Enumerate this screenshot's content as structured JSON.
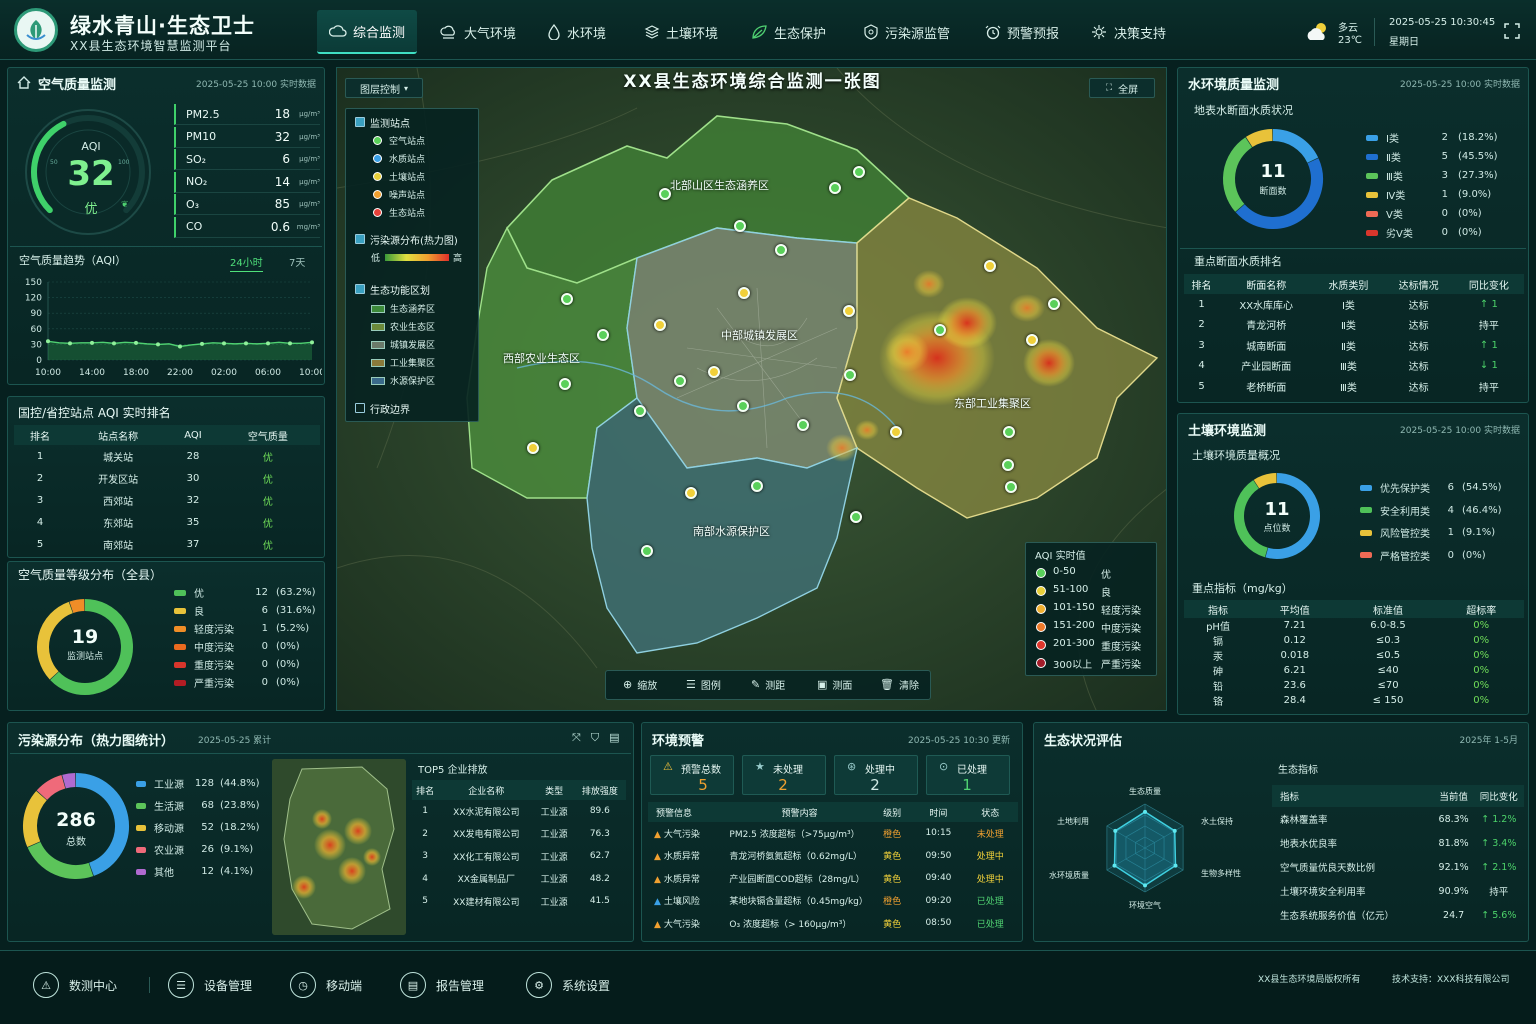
{
  "header": {
    "title": "绿水青山·生态卫士",
    "subtitle": "XX县生态环境智慧监测平台",
    "nav": [
      {
        "label": "综合监测",
        "icon": "cloud-monitor-icon",
        "active": true
      },
      {
        "label": "大气环境",
        "icon": "air-icon"
      },
      {
        "label": "水环境",
        "icon": "water-drop-icon"
      },
      {
        "label": "土壤环境",
        "icon": "soil-icon"
      },
      {
        "label": "生态保护",
        "icon": "leaf-icon"
      },
      {
        "label": "污染源监管",
        "icon": "pollution-source-icon"
      },
      {
        "label": "预警预报",
        "icon": "alarm-icon"
      },
      {
        "label": "决策支持",
        "icon": "decision-icon"
      }
    ],
    "weather": {
      "desc": "多云",
      "temp": "23℃"
    },
    "datetime": "2025-05-25  10:30:45",
    "weekday": "星期日"
  },
  "air": {
    "title": "空气质量监测",
    "meta": "2025-05-25  10:00  实时数据",
    "aqi_label": "AQI",
    "aqi_value": "32",
    "aqi_level": "优",
    "aqi_fraction": 0.16,
    "pollutants": [
      {
        "name": "PM2.5",
        "value": "18",
        "unit": "μg/m³"
      },
      {
        "name": "PM10",
        "value": "32",
        "unit": "μg/m³"
      },
      {
        "name": "SO₂",
        "value": "6",
        "unit": "μg/m³"
      },
      {
        "name": "NO₂",
        "value": "14",
        "unit": "μg/m³"
      },
      {
        "name": "O₃",
        "value": "85",
        "unit": "μg/m³"
      },
      {
        "name": "CO",
        "value": "0.6",
        "unit": "mg/m³"
      }
    ],
    "trend_title": "空气质量趋势（AQI）",
    "trend_tabs": [
      "24小时",
      "7天"
    ]
  },
  "chart_data": {
    "type": "line",
    "title": "空气质量趋势（AQI）",
    "x": [
      "10:00",
      "11:00",
      "12:00",
      "13:00",
      "14:00",
      "15:00",
      "16:00",
      "17:00",
      "18:00",
      "19:00",
      "20:00",
      "21:00",
      "22:00",
      "23:00",
      "00:00",
      "01:00",
      "02:00",
      "03:00",
      "04:00",
      "05:00",
      "06:00",
      "07:00",
      "08:00",
      "09:00",
      "10:00"
    ],
    "xticks": [
      "10:00",
      "14:00",
      "18:00",
      "22:00",
      "02:00",
      "06:00",
      "10:00"
    ],
    "values": [
      36,
      33,
      32,
      33,
      33,
      34,
      32,
      34,
      33,
      31,
      30,
      31,
      26,
      29,
      31,
      33,
      32,
      31,
      32,
      31,
      32,
      34,
      32,
      32,
      34
    ],
    "yticks": [
      0,
      30,
      60,
      90,
      120,
      150
    ],
    "ylim": [
      0,
      150
    ],
    "color": "#4fd071"
  },
  "aqi_rank": {
    "title": "国控/省控站点 AQI 实时排名",
    "headers": [
      "排名",
      "站点名称",
      "AQI",
      "空气质量"
    ],
    "rows": [
      [
        "1",
        "城关站",
        "28",
        "优"
      ],
      [
        "2",
        "开发区站",
        "30",
        "优"
      ],
      [
        "3",
        "西郊站",
        "32",
        "优"
      ],
      [
        "4",
        "东郊站",
        "35",
        "优"
      ],
      [
        "5",
        "南郊站",
        "37",
        "优"
      ]
    ]
  },
  "aqi_dist": {
    "title": "空气质量等级分布（全县）",
    "total": "19",
    "total_label": "监测站点",
    "items": [
      {
        "name": "优",
        "count": "12",
        "pct": "(63.2%)",
        "value": 12,
        "color": "#4fc159"
      },
      {
        "name": "良",
        "count": "6",
        "pct": "(31.6%)",
        "value": 6,
        "color": "#e8c23a"
      },
      {
        "name": "轻度污染",
        "count": "1",
        "pct": "(5.2%)",
        "value": 1,
        "color": "#f08d27"
      },
      {
        "name": "中度污染",
        "count": "0",
        "pct": "(0%)",
        "value": 0,
        "color": "#ea6a1f"
      },
      {
        "name": "重度污染",
        "count": "0",
        "pct": "(0%)",
        "value": 0,
        "color": "#d9362c"
      },
      {
        "name": "严重污染",
        "count": "0",
        "pct": "(0%)",
        "value": 0,
        "color": "#b31d24"
      }
    ]
  },
  "map": {
    "title": "XX县生态环境综合监测一张图",
    "layer_btn": "图层控制",
    "fullscreen": "全屏",
    "layers": {
      "stations_title": "监测站点",
      "stations": [
        {
          "label": "空气站点",
          "color": "#5ad05a"
        },
        {
          "label": "水质站点",
          "color": "#3aa0e6"
        },
        {
          "label": "土壤站点",
          "color": "#e8d03a"
        },
        {
          "label": "噪声站点",
          "color": "#f0a030"
        },
        {
          "label": "生态站点",
          "color": "#e8413a"
        }
      ],
      "heat_title": "污染源分布(热力图)",
      "heat_low": "低",
      "heat_high": "高",
      "zones_title": "生态功能区划",
      "zones": [
        {
          "label": "生态涵养区",
          "color": "#3d8a3a"
        },
        {
          "label": "农业生态区",
          "color": "#6c8a3a"
        },
        {
          "label": "城镇发展区",
          "color": "#6b7a6a"
        },
        {
          "label": "工业集聚区",
          "color": "#8a7a3a"
        },
        {
          "label": "水源保护区",
          "color": "#3a6a8a"
        }
      ],
      "boundary": "行政边界"
    },
    "regions": {
      "north": "北部山区生态涵养区",
      "west": "西部农业生态区",
      "center": "中部城镇发展区",
      "east": "东部工业集聚区",
      "south": "南部水源保护区"
    },
    "aqi_legend_title": "AQI 实时值",
    "aqi_legend": [
      {
        "range": "0-50",
        "level": "优",
        "color": "#5ad05a"
      },
      {
        "range": "51-100",
        "level": "良",
        "color": "#e8d03a"
      },
      {
        "range": "101-150",
        "level": "轻度污染",
        "color": "#f0b030"
      },
      {
        "range": "151-200",
        "level": "中度污染",
        "color": "#ef7a2a"
      },
      {
        "range": "201-300",
        "level": "重度污染",
        "color": "#e0372d"
      },
      {
        "range": "300以上",
        "level": "严重污染",
        "color": "#a31d2a"
      }
    ],
    "tools": [
      {
        "label": "缩放",
        "icon": "zoom-icon"
      },
      {
        "label": "图例",
        "icon": "legend-icon"
      },
      {
        "label": "测距",
        "icon": "ruler-icon"
      },
      {
        "label": "测面",
        "icon": "area-measure-icon"
      },
      {
        "label": "清除",
        "icon": "trash-icon"
      }
    ]
  },
  "water": {
    "title": "水环境质量监测",
    "meta": "2025-05-25  10:00  实时数据",
    "section_title": "地表水断面水质状况",
    "total": "11",
    "total_label": "断面数",
    "classes": [
      {
        "name": "Ⅰ类",
        "count": "2",
        "pct": "(18.2%)",
        "value": 2,
        "color": "#3aa0e6"
      },
      {
        "name": "Ⅱ类",
        "count": "5",
        "pct": "(45.5%)",
        "value": 5,
        "color": "#1f6fd0"
      },
      {
        "name": "Ⅲ类",
        "count": "3",
        "pct": "(27.3%)",
        "value": 3,
        "color": "#5cc45a"
      },
      {
        "name": "Ⅳ类",
        "count": "1",
        "pct": "(9.0%)",
        "value": 1,
        "color": "#e8c23a"
      },
      {
        "name": "Ⅴ类",
        "count": "0",
        "pct": "(0%)",
        "value": 0,
        "color": "#ef6a55"
      },
      {
        "name": "劣Ⅴ类",
        "count": "0",
        "pct": "(0%)",
        "value": 0,
        "color": "#d9362c"
      }
    ],
    "rank_title": "重点断面水质排名",
    "rank_headers": [
      "排名",
      "断面名称",
      "水质类别",
      "达标情况",
      "同比变化"
    ],
    "rank_rows": [
      {
        "cells": [
          "1",
          "XX水库库心",
          "Ⅰ类",
          "达标"
        ],
        "change": "↑ 1",
        "dir": "up"
      },
      {
        "cells": [
          "2",
          "青龙河桥",
          "Ⅱ类",
          "达标"
        ],
        "change": "持平",
        "dir": "flat"
      },
      {
        "cells": [
          "3",
          "城南断面",
          "Ⅱ类",
          "达标"
        ],
        "change": "↑ 1",
        "dir": "up"
      },
      {
        "cells": [
          "4",
          "产业园断面",
          "Ⅲ类",
          "达标"
        ],
        "change": "↓ 1",
        "dir": "down"
      },
      {
        "cells": [
          "5",
          "老桥断面",
          "Ⅲ类",
          "达标"
        ],
        "change": "持平",
        "dir": "flat"
      }
    ]
  },
  "soil": {
    "title": "土壤环境监测",
    "meta": "2025-05-25  10:00  实时数据",
    "section_title": "土壤环境质量概况",
    "total": "11",
    "total_label": "点位数",
    "classes": [
      {
        "name": "优先保护类",
        "count": "6",
        "pct": "(54.5%)",
        "value": 6,
        "color": "#3aa0e6"
      },
      {
        "name": "安全利用类",
        "count": "4",
        "pct": "(46.4%)",
        "value": 4,
        "color": "#4fc159"
      },
      {
        "name": "风险管控类",
        "count": "1",
        "pct": "(9.1%)",
        "value": 1,
        "color": "#e8c23a"
      },
      {
        "name": "严格管控类",
        "count": "0",
        "pct": "(0%)",
        "value": 0,
        "color": "#ef6a55"
      }
    ],
    "index_title": "重点指标（mg/kg）",
    "index_headers": [
      "指标",
      "平均值",
      "标准值",
      "超标率"
    ],
    "index_rows": [
      [
        "pH值",
        "7.21",
        "6.0-8.5",
        "0%"
      ],
      [
        "镉",
        "0.12",
        "≤0.3",
        "0%"
      ],
      [
        "汞",
        "0.018",
        "≤0.5",
        "0%"
      ],
      [
        "砷",
        "6.21",
        "≤40",
        "0%"
      ],
      [
        "铅",
        "23.6",
        "≤70",
        "0%"
      ],
      [
        "铬",
        "28.4",
        "≤ 150",
        "0%"
      ]
    ]
  },
  "pollution": {
    "title": "污染源分布（热力图统计）",
    "meta": "2025-05-25   累计",
    "total": "286",
    "total_label": "总数",
    "items": [
      {
        "name": "工业源",
        "count": "128",
        "pct": "(44.8%)",
        "value": 128,
        "color": "#3aa0e6"
      },
      {
        "name": "生活源",
        "count": "68",
        "pct": "(23.8%)",
        "value": 68,
        "color": "#5cc45a"
      },
      {
        "name": "移动源",
        "count": "52",
        "pct": "(18.2%)",
        "value": 52,
        "color": "#e8c23a"
      },
      {
        "name": "农业源",
        "count": "26",
        "pct": "(9.1%)",
        "value": 26,
        "color": "#ef6a7a"
      },
      {
        "name": "其他",
        "count": "12",
        "pct": "(4.1%)",
        "value": 12,
        "color": "#b06ad0"
      }
    ],
    "top_title": "TOP5 企业排放",
    "top_headers": [
      "排名",
      "企业名称",
      "类型",
      "排放强度"
    ],
    "top_rows": [
      [
        "1",
        "XX水泥有限公司",
        "工业源",
        "89.6"
      ],
      [
        "2",
        "XX发电有限公司",
        "工业源",
        "76.3"
      ],
      [
        "3",
        "XX化工有限公司",
        "工业源",
        "62.7"
      ],
      [
        "4",
        "XX金属制品厂",
        "工业源",
        "48.2"
      ],
      [
        "5",
        "XX建材有限公司",
        "工业源",
        "41.5"
      ]
    ]
  },
  "warning": {
    "title": "环境预警",
    "meta": "2025-05-25  10:30  更新",
    "stats": [
      {
        "label": "预警总数",
        "value": "5",
        "color": "#f0a030",
        "icon": "warning-triangle-icon"
      },
      {
        "label": "未处理",
        "value": "2",
        "color": "#f0a030",
        "icon": "star-icon"
      },
      {
        "label": "处理中",
        "value": "2",
        "color": "#cfe9e4",
        "icon": "processing-icon"
      },
      {
        "label": "已处理",
        "value": "1",
        "color": "#4fd071",
        "icon": "done-icon"
      }
    ],
    "headers": [
      "预警信息",
      "预警内容",
      "级别",
      "时间",
      "状态"
    ],
    "rows": [
      {
        "type": "大气污染",
        "content": "PM2.5 浓度超标（>75μg/m³）",
        "level": "橙色",
        "time": "10:15",
        "status": "未处理",
        "tcolor": "#f0a030",
        "lcolor": "#f0a030",
        "scolor": "#f0a030"
      },
      {
        "type": "水质异常",
        "content": "青龙河桥氨氮超标（0.62mg/L）",
        "level": "黄色",
        "time": "09:50",
        "status": "处理中",
        "tcolor": "#f0a030",
        "lcolor": "#f0d03a",
        "scolor": "#f0d03a"
      },
      {
        "type": "水质异常",
        "content": "产业园断面COD超标（28mg/L）",
        "level": "黄色",
        "time": "09:40",
        "status": "处理中",
        "tcolor": "#f0a030",
        "lcolor": "#f0d03a",
        "scolor": "#f0d03a"
      },
      {
        "type": "土壤风险",
        "content": "某地块镉含量超标（0.45mg/kg）",
        "level": "橙色",
        "time": "09:20",
        "status": "已处理",
        "tcolor": "#3aa0e6",
        "lcolor": "#f0a030",
        "scolor": "#4fd071"
      },
      {
        "type": "大气污染",
        "content": "O₃ 浓度超标（> 160μg/m³）",
        "level": "黄色",
        "time": "08:50",
        "status": "已处理",
        "tcolor": "#f0a030",
        "lcolor": "#f0d03a",
        "scolor": "#4fd071"
      }
    ]
  },
  "eco": {
    "title": "生态状况评估",
    "meta": "2025年   1-5月",
    "radar_axes": [
      "生态质量",
      "水土保持",
      "生物多样性",
      "环境空气",
      "水环境质量",
      "土地利用"
    ],
    "radar_values": [
      0.82,
      0.78,
      0.8,
      0.85,
      0.8,
      0.78
    ],
    "table_title": "生态指标",
    "headers": [
      "指标",
      "当前值",
      "同比变化"
    ],
    "rows": [
      {
        "name": "森林覆盖率",
        "value": "68.3%",
        "change": "↑ 1.2%",
        "dir": "up"
      },
      {
        "name": "地表水优良率",
        "value": "81.8%",
        "change": "↑ 3.4%",
        "dir": "up"
      },
      {
        "name": "空气质量优良天数比例",
        "value": "92.1%",
        "change": "↑ 2.1%",
        "dir": "up"
      },
      {
        "name": "土壤环境安全利用率",
        "value": "90.9%",
        "change": "持平",
        "dir": "flat"
      },
      {
        "name": "生态系统服务价值（亿元）",
        "value": "24.7",
        "change": "↑ 5.6%",
        "dir": "up"
      }
    ]
  },
  "footer": {
    "items": [
      {
        "label": "数测中心",
        "icon": "data-center-icon"
      },
      {
        "label": "设备管理",
        "icon": "device-icon"
      },
      {
        "label": "移动端",
        "icon": "mobile-icon"
      },
      {
        "label": "报告管理",
        "icon": "report-icon"
      },
      {
        "label": "系统设置",
        "icon": "settings-icon"
      }
    ],
    "copyright": "XX县生态环境局版权所有",
    "support": "技术支持：XXX科技有限公司"
  }
}
